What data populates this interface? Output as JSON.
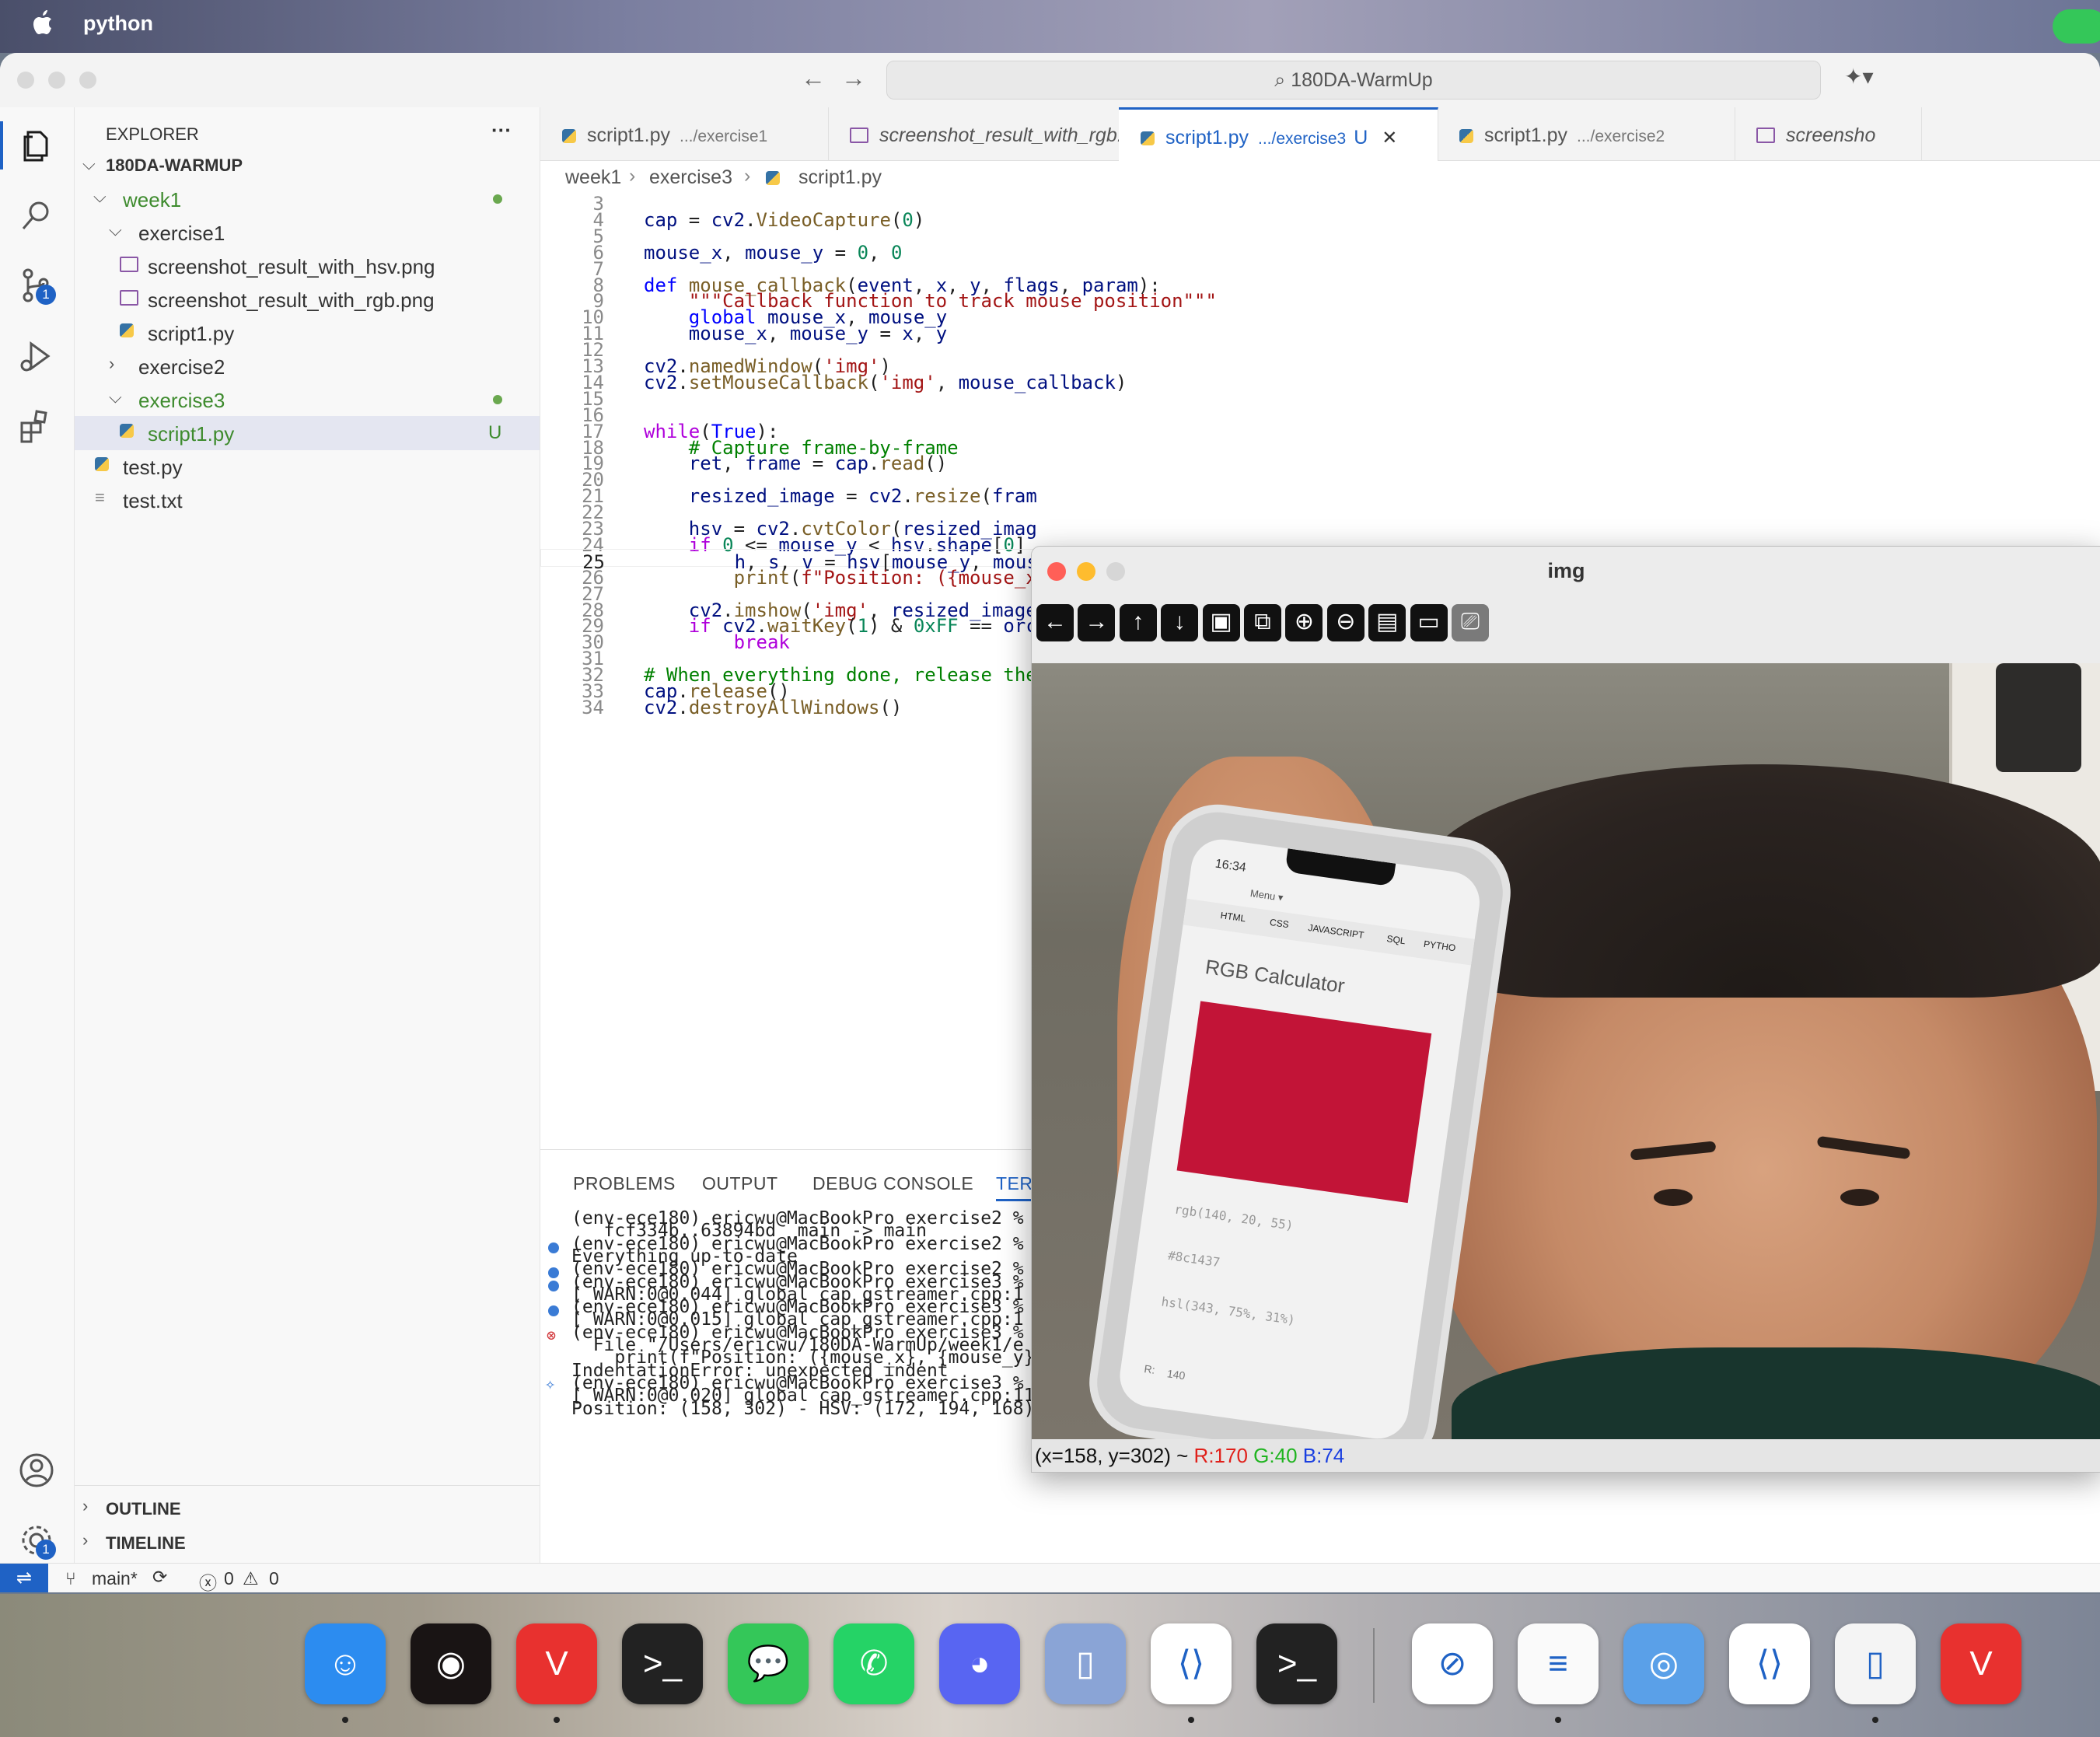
{
  "menubar": {
    "app_name": "python"
  },
  "titlebar": {
    "search_text": "180DA-WarmUp"
  },
  "sidebar": {
    "header": "EXPLORER",
    "more": "···",
    "workspace": "180DA-WARMUP",
    "tree": [
      {
        "label": "week1",
        "indent": 1,
        "kind": "folder-open",
        "status": "dot"
      },
      {
        "label": "exercise1",
        "indent": 2,
        "kind": "folder-open",
        "status": ""
      },
      {
        "label": "screenshot_result_with_hsv.png",
        "indent": 3,
        "kind": "image",
        "status": ""
      },
      {
        "label": "screenshot_result_with_rgb.png",
        "indent": 3,
        "kind": "image",
        "status": ""
      },
      {
        "label": "script1.py",
        "indent": 3,
        "kind": "python",
        "status": ""
      },
      {
        "label": "exercise2",
        "indent": 2,
        "kind": "folder-closed",
        "status": ""
      },
      {
        "label": "exercise3",
        "indent": 2,
        "kind": "folder-open",
        "status": "dot"
      },
      {
        "label": "script1.py",
        "indent": 3,
        "kind": "python",
        "status": "U"
      },
      {
        "label": "test.py",
        "indent": 1,
        "kind": "python",
        "status": ""
      },
      {
        "label": "test.txt",
        "indent": 1,
        "kind": "text",
        "status": ""
      }
    ],
    "outline": "OUTLINE",
    "timeline": "TIMELINE"
  },
  "activity": {
    "scm_badge": "1",
    "settings_badge": "1"
  },
  "tabs": [
    {
      "label": "script1.py",
      "desc": ".../exercise1",
      "type": "python"
    },
    {
      "label": "screenshot_result_with_rgb.png",
      "desc": ".../exercise1",
      "type": "image"
    },
    {
      "label": "script1.py",
      "desc": ".../exercise3",
      "type": "python",
      "status": "U",
      "active": true
    },
    {
      "label": "script1.py",
      "desc": ".../exercise2",
      "type": "python"
    },
    {
      "label": "screensho",
      "desc": "",
      "type": "image"
    }
  ],
  "breadcrumb": [
    "week1",
    "exercise3",
    "script1.py"
  ],
  "code_lines": [
    {
      "n": "3",
      "t": ""
    },
    {
      "n": "4",
      "t": "cap = cv2.VideoCapture(0)"
    },
    {
      "n": "5",
      "t": ""
    },
    {
      "n": "6",
      "t": "mouse_x, mouse_y = 0, 0"
    },
    {
      "n": "7",
      "t": ""
    },
    {
      "n": "8",
      "t": "def mouse_callback(event, x, y, flags, param):"
    },
    {
      "n": "9",
      "t": "    \"\"\"Callback function to track mouse position\"\"\""
    },
    {
      "n": "10",
      "t": "    global mouse_x, mouse_y"
    },
    {
      "n": "11",
      "t": "    mouse_x, mouse_y = x, y"
    },
    {
      "n": "12",
      "t": ""
    },
    {
      "n": "13",
      "t": "cv2.namedWindow('img')"
    },
    {
      "n": "14",
      "t": "cv2.setMouseCallback('img', mouse_callback)"
    },
    {
      "n": "15",
      "t": ""
    },
    {
      "n": "16",
      "t": ""
    },
    {
      "n": "17",
      "t": "while(True):"
    },
    {
      "n": "18",
      "t": "    # Capture frame-by-frame"
    },
    {
      "n": "19",
      "t": "    ret, frame = cap.read()"
    },
    {
      "n": "20",
      "t": ""
    },
    {
      "n": "21",
      "t": "    resized_image = cv2.resize(fram"
    },
    {
      "n": "22",
      "t": ""
    },
    {
      "n": "23",
      "t": "    hsv = cv2.cvtColor(resized_imag"
    },
    {
      "n": "24",
      "t": "    if 0 <= mouse_y < hsv.shape[0]"
    },
    {
      "n": "25",
      "t": "        h, s, v = hsv[mouse_y, mous"
    },
    {
      "n": "26",
      "t": "        print(f\"Position: ({mouse_x"
    },
    {
      "n": "27",
      "t": ""
    },
    {
      "n": "28",
      "t": "    cv2.imshow('img', resized_image"
    },
    {
      "n": "29",
      "t": "    if cv2.waitKey(1) & 0xFF == orc"
    },
    {
      "n": "30",
      "t": "        break"
    },
    {
      "n": "31",
      "t": ""
    },
    {
      "n": "32",
      "t": "# When everything done, release the"
    },
    {
      "n": "33",
      "t": "cap.release()"
    },
    {
      "n": "34",
      "t": "cv2.destroyAllWindows()"
    }
  ],
  "panel": {
    "tabs": [
      "PROBLEMS",
      "OUTPUT",
      "DEBUG CONSOLE",
      "TERM"
    ],
    "terminal": [
      {
        "t": "(env-ece180) ericwu@MacBookPro exercise2 %",
        "mark": ""
      },
      {
        "t": "   fcf334b..63894bd  main -> main",
        "mark": ""
      },
      {
        "t": "(env-ece180) ericwu@MacBookPro exercise2 %",
        "mark": "blue"
      },
      {
        "t": "Everything up-to-date",
        "mark": ""
      },
      {
        "t": "(env-ece180) ericwu@MacBookPro exercise2 %",
        "mark": "blue"
      },
      {
        "t": "(env-ece180) ericwu@MacBookPro exercise3 %",
        "mark": "blue"
      },
      {
        "t": "[ WARN:0@0.044] global cap_gstreamer.cpp:1",
        "mark": ""
      },
      {
        "t": "(env-ece180) ericwu@MacBookPro exercise3 %",
        "mark": "blue"
      },
      {
        "t": "[ WARN:0@0.015] global cap_gstreamer.cpp:1",
        "mark": ""
      },
      {
        "t": "(env-ece180) ericwu@MacBookPro exercise3 %",
        "mark": "error"
      },
      {
        "t": "  File \"/Users/ericwu/180DA-WarmUp/week1/e",
        "mark": ""
      },
      {
        "t": "    print(f\"Position: ({mouse_x}, {mouse_y}",
        "mark": ""
      },
      {
        "t": "IndentationError: unexpected indent",
        "mark": ""
      },
      {
        "t": "(env-ece180) ericwu@MacBookPro exercise3 % python script1.py",
        "mark": "sparkle"
      },
      {
        "t": "[ WARN:0@0.020] global cap_gstreamer.cpp:1173 isPipelinePlaying OpenCV | GStreamer warning: GStreamer: pipeline have not been created",
        "mark": ""
      },
      {
        "t": "Position: (158, 302) - HSV: (172, 194, 168)",
        "mark": ""
      }
    ]
  },
  "statusbar": {
    "branch": "main*",
    "errors": "0",
    "warnings": "0"
  },
  "img_window": {
    "title": "img",
    "toolbar": [
      "arrow-left",
      "arrow-right",
      "arrow-up",
      "arrow-down",
      "image",
      "image-zoom",
      "zoom-in",
      "zoom-out",
      "save",
      "clipboard",
      "brush"
    ],
    "pixel_info": {
      "coords": "(x=158, y=302) ~",
      "r": "R:170",
      "g": "G:40",
      "b": "B:74"
    },
    "phone": {
      "time": "16:34",
      "menu": "Menu ▾",
      "nav": [
        "HTML",
        "CSS",
        "JAVASCRIPT",
        "SQL",
        "PYTHO"
      ],
      "heading": "RGB Calculator",
      "swatch_color": "#c21437",
      "rgb": "rgb(140, 20, 55)",
      "hex": "#8c1437",
      "hsl": "hsl(343, 75%, 31%)",
      "r_label": "R:",
      "r_value": "140"
    }
  },
  "dock": [
    {
      "name": "finder",
      "color": "#2c8cf0",
      "dot": true
    },
    {
      "name": "spotify",
      "color": "#191414",
      "dot": false
    },
    {
      "name": "vivaldi",
      "color": "#e8312f",
      "dot": true
    },
    {
      "name": "terminal",
      "color": "#222222",
      "dot": false
    },
    {
      "name": "messages",
      "color": "#34c759",
      "dot": false
    },
    {
      "name": "whatsapp",
      "color": "#25d366",
      "dot": false
    },
    {
      "name": "discord",
      "color": "#5865f2",
      "dot": false
    },
    {
      "name": "simulator",
      "color": "#8aa4d6",
      "dot": false
    },
    {
      "name": "vscode",
      "color": "#ffffff",
      "dot": true
    },
    {
      "name": "terminal",
      "color": "#222222",
      "dot": false
    },
    {
      "name": "safari",
      "color": "#ffffff",
      "dot": false
    },
    {
      "name": "notes",
      "color": "#fafafa",
      "dot": true
    },
    {
      "name": "camera-app",
      "color": "#5aa0e8",
      "dot": false
    },
    {
      "name": "vscode",
      "color": "#ffffff",
      "dot": false
    },
    {
      "name": "document",
      "color": "#f4f4f4",
      "dot": true
    },
    {
      "name": "vivaldi",
      "color": "#e8312f",
      "dot": false
    }
  ]
}
